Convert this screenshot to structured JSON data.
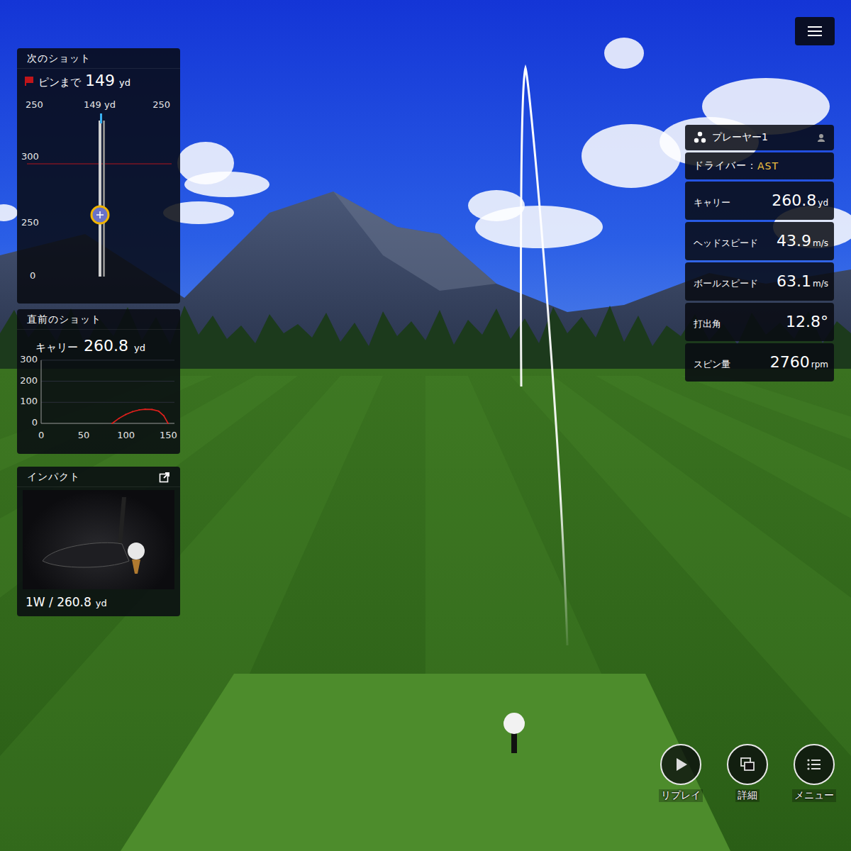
{
  "next_shot": {
    "title": "次のショット",
    "pin_label": "ピンまで",
    "pin_distance": "149",
    "unit": "yd",
    "chart": {
      "left_label": "250",
      "center_value": "149",
      "center_unit": "yd",
      "right_label": "250",
      "y_ticks": [
        "300",
        "250",
        "0"
      ],
      "ball_level": 0.38
    }
  },
  "last_shot": {
    "title": "直前のショット",
    "carry_label": "キャリー",
    "carry": "260.8",
    "unit": "yd",
    "chart": {
      "y_ticks": [
        "300",
        "200",
        "100",
        "0"
      ],
      "x_ticks": [
        "0",
        "50",
        "100",
        "150"
      ],
      "series": [
        {
          "name": "trajectory",
          "x": [
            84,
            92,
            100,
            108,
            116,
            123,
            131,
            139,
            145,
            150
          ],
          "y": [
            0,
            24,
            42,
            56,
            64,
            67,
            66,
            58,
            36,
            0
          ]
        }
      ]
    }
  },
  "impact": {
    "title": "インパクト",
    "club": "1W / 260.8",
    "unit": "yd"
  },
  "player": {
    "name": "プレーヤー1",
    "club_label": "ドライバー：",
    "club": "AST",
    "stats": [
      {
        "label": "キャリー",
        "value": "260.8",
        "unit": "yd"
      },
      {
        "label": "ヘッドスピード",
        "value": "43.9",
        "unit": "m/s"
      },
      {
        "label": "ボールスピード",
        "value": "63.1",
        "unit": "m/s"
      },
      {
        "label": "打出角",
        "value": "12.8°",
        "unit": ""
      },
      {
        "label": "スピン量",
        "value": "2760",
        "unit": "rpm"
      }
    ]
  },
  "buttons": [
    {
      "label": "リプレイ",
      "kind": "replay"
    },
    {
      "label": "詳細",
      "kind": "detail"
    },
    {
      "label": "メニュー",
      "kind": "menu"
    }
  ]
}
